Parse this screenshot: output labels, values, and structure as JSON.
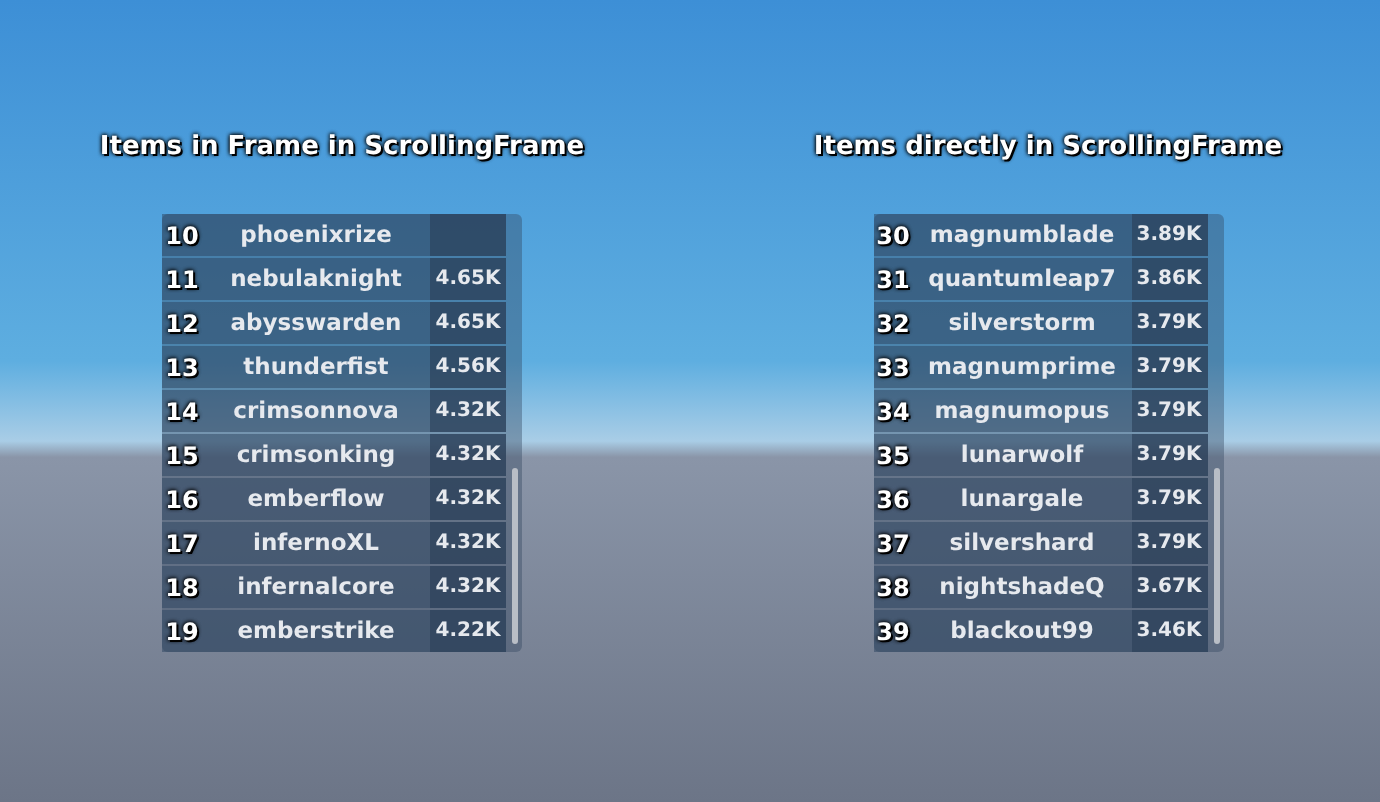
{
  "panels": [
    {
      "title": "Items in Frame in ScrollingFrame",
      "rows": [
        {
          "rank": "10",
          "name": "phoenixrize"
        },
        {
          "rank": "11",
          "name": "nebulaknight",
          "value": "4.65K"
        },
        {
          "rank": "12",
          "name": "abysswarden",
          "value": "4.65K"
        },
        {
          "rank": "13",
          "name": "thunderfist",
          "value": "4.56K"
        },
        {
          "rank": "14",
          "name": "crimsonnova",
          "value": "4.32K"
        },
        {
          "rank": "15",
          "name": "crimsonking",
          "value": "4.32K"
        },
        {
          "rank": "16",
          "name": "emberflow",
          "value": "4.32K"
        },
        {
          "rank": "17",
          "name": "infernoXL",
          "value": "4.32K"
        },
        {
          "rank": "18",
          "name": "infernalcore",
          "value": "4.32K"
        },
        {
          "rank": "19",
          "name": "emberstrike",
          "value": "4.22K"
        }
      ]
    },
    {
      "title": "Items directly in ScrollingFrame",
      "rows": [
        {
          "rank": "30",
          "name": "magnumblade",
          "value": "3.89K"
        },
        {
          "rank": "31",
          "name": "quantumleap7",
          "value": "3.86K"
        },
        {
          "rank": "32",
          "name": "silverstorm",
          "value": "3.79K"
        },
        {
          "rank": "33",
          "name": "magnumprime",
          "value": "3.79K"
        },
        {
          "rank": "34",
          "name": "magnumopus",
          "value": "3.79K"
        },
        {
          "rank": "35",
          "name": "lunarwolf",
          "value": "3.79K"
        },
        {
          "rank": "36",
          "name": "lunargale",
          "value": "3.79K"
        },
        {
          "rank": "37",
          "name": "silvershard",
          "value": "3.79K"
        },
        {
          "rank": "38",
          "name": "nightshadeQ",
          "value": "3.67K"
        },
        {
          "rank": "39",
          "name": "blackout99",
          "value": "3.46K"
        }
      ]
    }
  ]
}
